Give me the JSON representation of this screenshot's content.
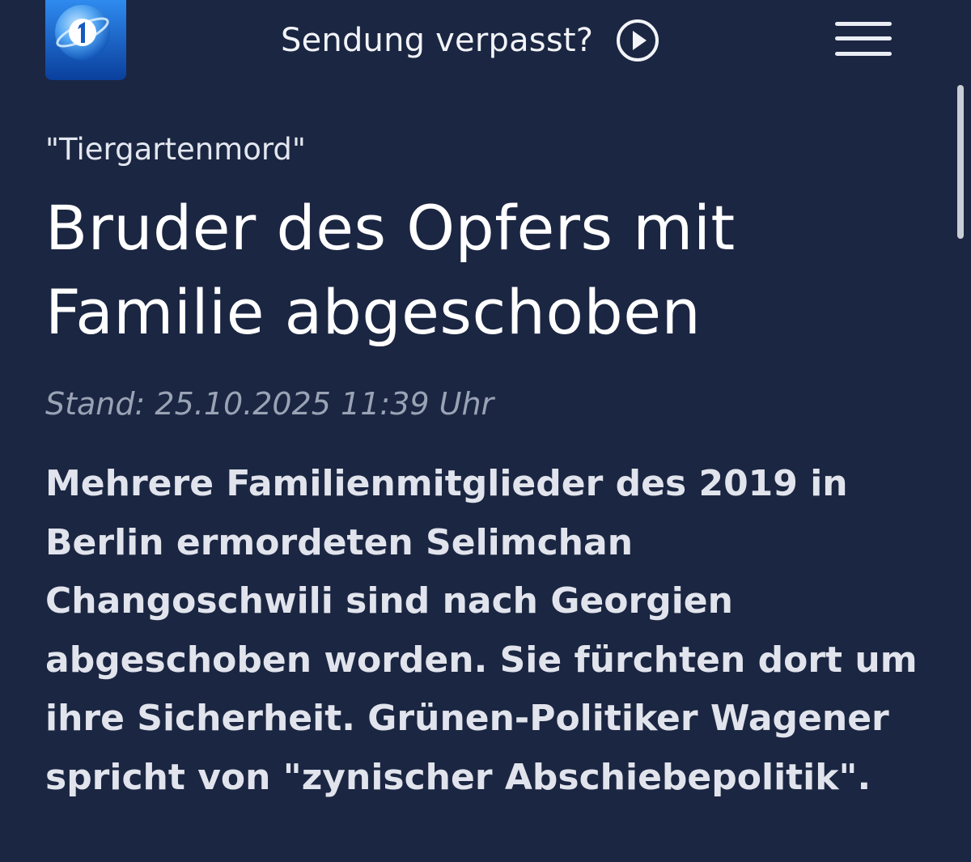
{
  "header": {
    "logo_icon": "ard-das-erste-logo-icon",
    "missed_label": "Sendung verpasst?",
    "missed_icon": "play-circle-icon",
    "menu_icon": "hamburger-menu-icon"
  },
  "article": {
    "topline": "\"Tiergartenmord\"",
    "headline": "Bruder des Opfers mit Familie abgeschoben",
    "dateline": "Stand: 25.10.2025 11:39 Uhr",
    "teaser": "Mehrere Familienmitglieder des 2019 in Berlin ermordeten Selimchan Changoschwili sind nach Georgien abgeschoben worden. Sie fürchten dort um ihre Sicherheit. Grünen-Politiker Wagener spricht von \"zynischer Abschiebepolitik\"."
  },
  "colors": {
    "background": "#1b2642",
    "text": "#ffffff",
    "dateline": "#9aa3b5",
    "logo_blue": "#1565c0"
  }
}
